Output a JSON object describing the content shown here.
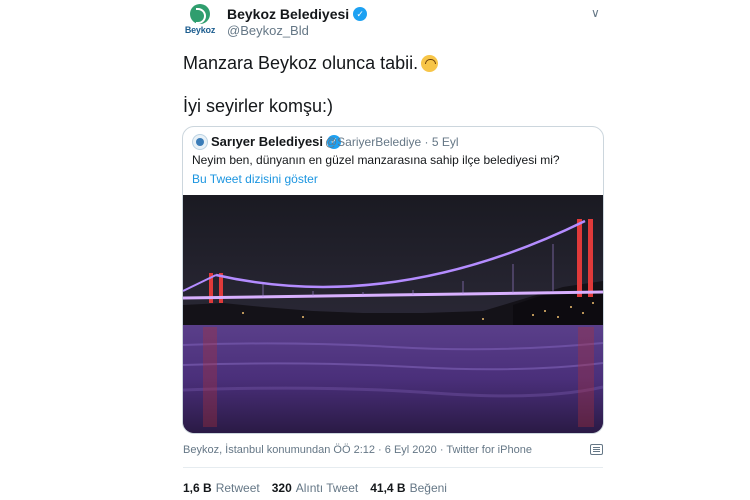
{
  "author": {
    "name": "Beykoz Belediyesi",
    "handle": "@Beykoz_Bld",
    "avatar_text": "Beykoz"
  },
  "tweet": {
    "line1": "Manzara Beykoz olunca tabii.",
    "line2": "İyi seyirler komşu:)"
  },
  "quoted": {
    "name": "Sarıyer Belediyesi",
    "meta": "@SariyerBelediye · 5 Eyl",
    "text": "Neyim ben, dünyanın en güzel manzarasına sahip ilçe belediyesi mi?",
    "thread_link": "Bu Tweet dizisini göster"
  },
  "meta_line": "Beykoz, İstanbul konumundan ÖÖ 2:12 · 6 Eyl 2020 · Twitter for iPhone",
  "stats": {
    "retweets_count": "1,6 B",
    "retweets_label": "Retweet",
    "quotes_count": "320",
    "quotes_label": "Alıntı Tweet",
    "likes_count": "41,4 B",
    "likes_label": "Beğeni"
  },
  "icons": {
    "verified": "verified-badge-icon",
    "caret": "chevron-down-icon",
    "emoji": "upside-down-face-icon",
    "analytics": "analytics-icon"
  },
  "colors": {
    "accent": "#1da1f2",
    "link": "#1b95e0",
    "muted": "#657786"
  }
}
